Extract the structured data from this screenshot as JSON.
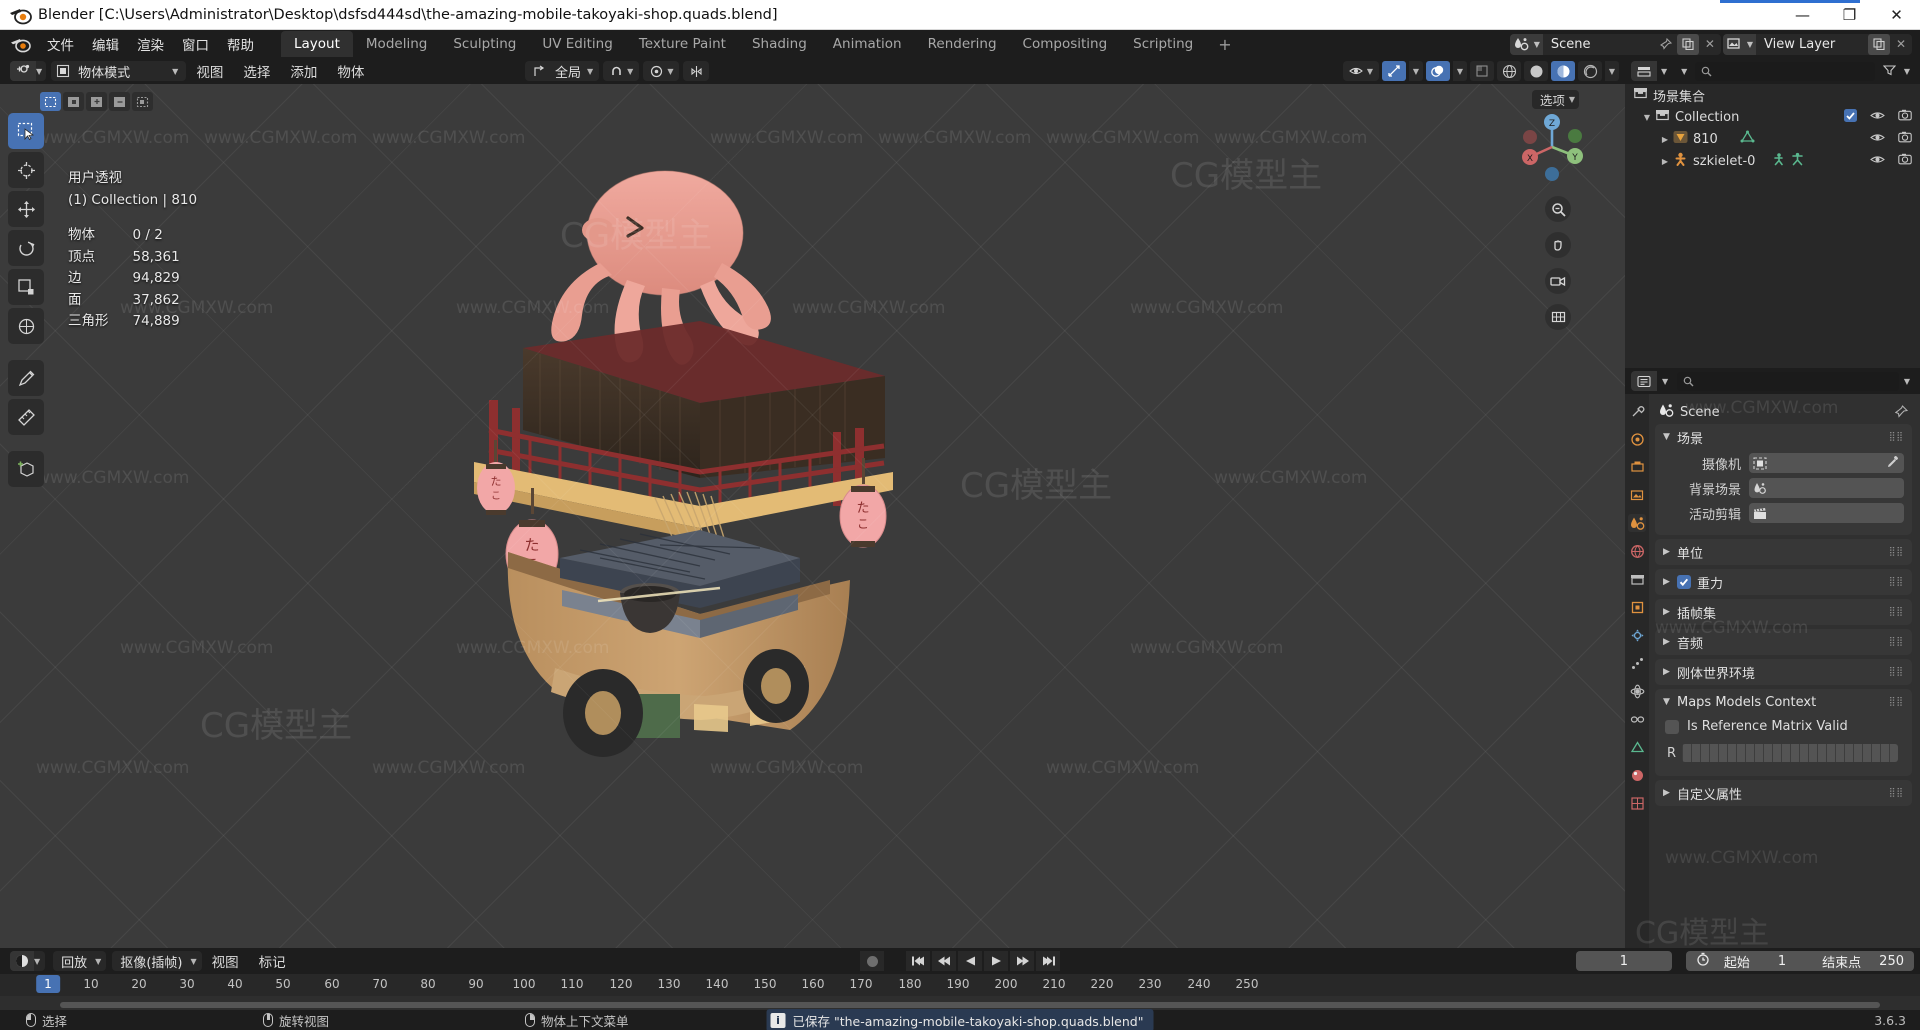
{
  "window": {
    "title": "Blender [C:\\Users\\Administrator\\Desktop\\dsfsd444sd\\the-amazing-mobile-takoyaki-shop.quads.blend]",
    "minimize": "—",
    "maximize": "❐",
    "close": "✕"
  },
  "menubar": {
    "items": [
      "文件",
      "编辑",
      "渲染",
      "窗口",
      "帮助"
    ],
    "workspace_tabs": [
      {
        "label": "Layout",
        "active": true
      },
      {
        "label": "Modeling",
        "active": false
      },
      {
        "label": "Sculpting",
        "active": false
      },
      {
        "label": "UV Editing",
        "active": false
      },
      {
        "label": "Texture Paint",
        "active": false
      },
      {
        "label": "Shading",
        "active": false
      },
      {
        "label": "Animation",
        "active": false
      },
      {
        "label": "Rendering",
        "active": false
      },
      {
        "label": "Compositing",
        "active": false
      },
      {
        "label": "Scripting",
        "active": false
      }
    ],
    "add_workspace": "+",
    "scene_name": "Scene",
    "view_layer_name": "View Layer"
  },
  "viewport_header": {
    "mode": "物体模式",
    "menus": [
      "视图",
      "选择",
      "添加",
      "物体"
    ],
    "transform_orientation": "全局",
    "selectability": "选项"
  },
  "viewport_stats": {
    "perspective": "用户透视",
    "collection_line": "(1) Collection | 810",
    "rows": [
      {
        "label": "物体",
        "value": "0 / 2"
      },
      {
        "label": "顶点",
        "value": "58,361"
      },
      {
        "label": "边",
        "value": "94,829"
      },
      {
        "label": "面",
        "value": "37,862"
      },
      {
        "label": "三角形",
        "value": "74,889"
      }
    ]
  },
  "outliner": {
    "search_placeholder": "",
    "scene_collection": "场景集合",
    "items": [
      {
        "label": "Collection",
        "indent": 1,
        "icon": "collection-icon",
        "expanded": true,
        "checkbox": true
      },
      {
        "label": "810",
        "indent": 2,
        "icon": "mesh-icon",
        "expanded": false,
        "checkbox": false
      },
      {
        "label": "szkielet-0",
        "indent": 2,
        "icon": "armature-icon",
        "expanded": false,
        "checkbox": false
      }
    ]
  },
  "properties": {
    "breadcrumb": "Scene",
    "panels": [
      {
        "title": "场景",
        "open": true,
        "fields": [
          {
            "label": "摄像机",
            "value": "",
            "icon": "camera-icon",
            "eyedropper": true
          },
          {
            "label": "背景场景",
            "value": "",
            "icon": "scene-icon",
            "eyedropper": false
          },
          {
            "label": "活动剪辑",
            "value": "",
            "icon": "clip-icon",
            "eyedropper": false
          }
        ]
      },
      {
        "title": "单位",
        "open": false,
        "fields": []
      },
      {
        "title": "重力",
        "open": false,
        "checkbox": true,
        "fields": []
      },
      {
        "title": "插帧集",
        "open": false,
        "fields": []
      },
      {
        "title": "音频",
        "open": false,
        "fields": []
      },
      {
        "title": "刚体世界环境",
        "open": false,
        "fields": []
      },
      {
        "title": "Maps Models Context",
        "open": true,
        "custom": {
          "checkbox_label": "Is Reference Matrix Valid",
          "checkbox_checked": false,
          "row_label": "R"
        }
      },
      {
        "title": "自定义属性",
        "open": false,
        "fields": []
      }
    ]
  },
  "timeline": {
    "editor_menus": [
      "回放",
      "抠像(插帧)"
    ],
    "menus": [
      "视图",
      "标记"
    ],
    "current_frame": "1",
    "start_label": "起始",
    "start_value": "1",
    "end_label": "结束点",
    "end_value": "250",
    "ruler_ticks": [
      10,
      20,
      30,
      40,
      50,
      60,
      70,
      80,
      90,
      100,
      110,
      120,
      130,
      140,
      150,
      160,
      170,
      180,
      190,
      200,
      210,
      220,
      230,
      240,
      250
    ],
    "playhead_frame": "1"
  },
  "statusbar": {
    "hints": [
      {
        "mouse": "left",
        "label": "选择"
      },
      {
        "mouse": "middle",
        "label": "旋转视图"
      },
      {
        "mouse": "right",
        "label": "物体上下文菜单"
      }
    ],
    "message": "已保存 \"the-amazing-mobile-takoyaki-shop.quads.blend\"",
    "version": "3.6.3"
  },
  "watermark": {
    "small": "www.CGMXW.com",
    "brand": "CG模型主"
  },
  "colors": {
    "accent_blue": "#4772b3",
    "bg_dark": "#1d1d1d",
    "viewport_bg": "#3b3b3b",
    "panel_bg": "#303030",
    "outliner_bg": "#282828"
  }
}
